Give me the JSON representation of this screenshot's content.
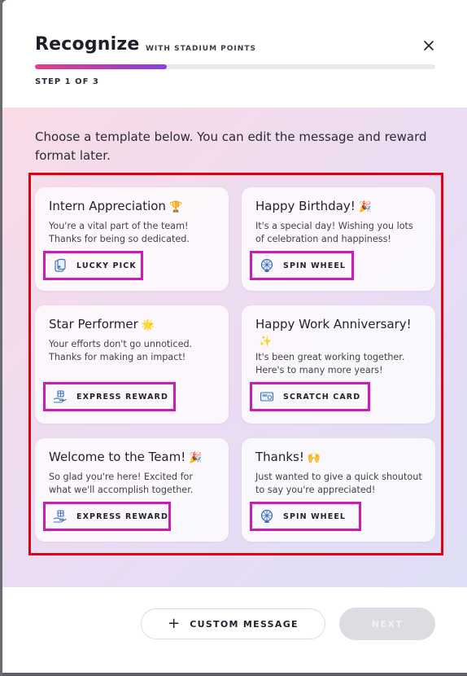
{
  "header": {
    "title": "Recognize",
    "subtitle": "WITH STADIUM POINTS",
    "step": "STEP 1 OF 3",
    "progress_fraction": 0.33,
    "close_icon": "close-icon"
  },
  "intro": "Choose a template below. You can edit the message and reward format later.",
  "templates": [
    {
      "title": "Intern Appreciation",
      "emoji": "🏆",
      "description": "You're a vital part of the team! Thanks for being so dedicated.",
      "reward": "LUCKY PICK",
      "reward_icon": "cards-icon"
    },
    {
      "title": "Happy Birthday!",
      "emoji": "🎉",
      "description": "It's a special day! Wishing you lots of celebration and happiness!",
      "reward": "SPIN WHEEL",
      "reward_icon": "spin-wheel-icon"
    },
    {
      "title": "Star Performer",
      "emoji": "🌟",
      "description": "Your efforts don't go unnoticed. Thanks for making an impact!",
      "reward": "EXPRESS REWARD",
      "reward_icon": "gift-hand-icon"
    },
    {
      "title": "Happy Work Anniversary!",
      "emoji": "✨",
      "description": "It's been great working together. Here's to many more years!",
      "reward": "SCRATCH CARD",
      "reward_icon": "scratch-card-icon"
    },
    {
      "title": "Welcome to the Team!",
      "emoji": "🎉",
      "description": "So glad you're here! Excited for what we'll accomplish together.",
      "reward": "EXPRESS REWARD",
      "reward_icon": "gift-hand-icon"
    },
    {
      "title": "Thanks!",
      "emoji": "🙌",
      "description": "Just wanted to give a quick shoutout to say you're appreciated!",
      "reward": "SPIN WHEEL",
      "reward_icon": "spin-wheel-icon"
    }
  ],
  "footer": {
    "custom_label": "CUSTOM MESSAGE",
    "next_label": "NEXT"
  },
  "colors": {
    "highlight_red": "#e00012",
    "highlight_magenta": "#cc19b9",
    "progress_start": "#e63d8b",
    "progress_end": "#8a3fe0",
    "icon_blue": "#3d6fb3"
  }
}
